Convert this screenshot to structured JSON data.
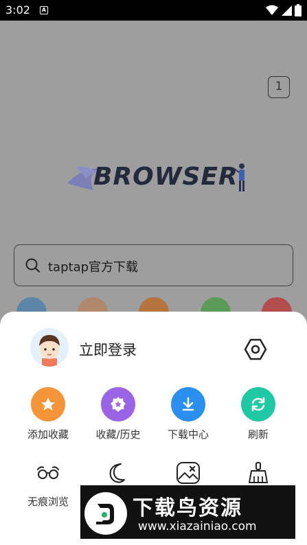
{
  "status_bar": {
    "time": "3:02",
    "a_badge": "A"
  },
  "browser": {
    "tab_count": "1",
    "logo_text": "BROWSER",
    "search_text": "taptap官方下载"
  },
  "menu": {
    "login_label": "立即登录",
    "actions": [
      {
        "label": "添加收藏",
        "icon": "star-icon",
        "color": "#f6943a"
      },
      {
        "label": "收藏/历史",
        "icon": "star-badge-icon",
        "color": "#9b63e6"
      },
      {
        "label": "下载中心",
        "icon": "download-icon",
        "color": "#2b8ff0"
      },
      {
        "label": "刷新",
        "icon": "refresh-icon",
        "color": "#1ec9a4"
      }
    ],
    "second_row": [
      {
        "label": "无痕浏览",
        "icon": "incognito-glasses-icon"
      },
      {
        "label": "",
        "icon": "moon-icon"
      },
      {
        "label": "",
        "icon": "no-image-icon"
      },
      {
        "label": "",
        "icon": "broom-icon"
      }
    ]
  },
  "watermark": {
    "title": "下载鸟资源",
    "url": "www.xiazainiao.com"
  }
}
